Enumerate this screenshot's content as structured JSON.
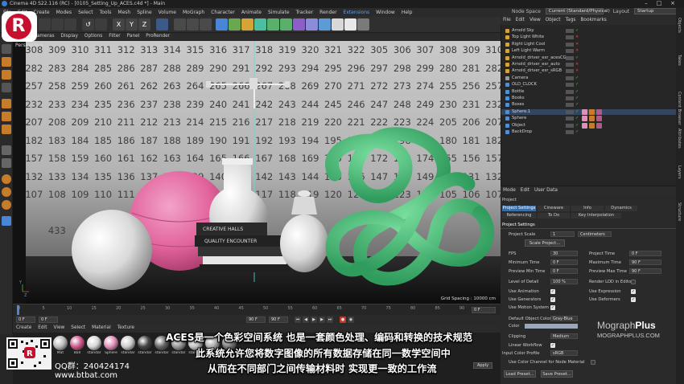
{
  "window": {
    "title": "Cinema 4D S22.116 (RC) - [0105_Setting_Up_ACES.c4d *] - Main"
  },
  "menubar": {
    "items": [
      "File",
      "Edit",
      "Create",
      "Modes",
      "Select",
      "Tools",
      "Mesh",
      "Spline",
      "Volume",
      "MoGraph",
      "Character",
      "Animate",
      "Simulate",
      "Tracker",
      "Render",
      "Extensions",
      "Window",
      "Help"
    ],
    "highlighted": "Extensions"
  },
  "node_space": {
    "label": "Node Space",
    "value": "Current (Standard/Physical)",
    "layout_label": "Layout",
    "layout_value": "Startup"
  },
  "viewport": {
    "menu": [
      "View",
      "Cameras",
      "Display",
      "Options",
      "Filter",
      "Panel",
      "ProRender"
    ],
    "label": "Perspective",
    "grid_spacing": "Grid Spacing : 10000 cm",
    "backdrop_rows": [
      [
        "308",
        "309",
        "310",
        "311",
        "312",
        "313",
        "314",
        "315",
        "316",
        "317",
        "318",
        "319",
        "320",
        "321",
        "322",
        "305",
        "306",
        "307",
        "308",
        "309",
        "310"
      ],
      [
        "282",
        "283",
        "284",
        "285",
        "286",
        "287",
        "288",
        "289",
        "290",
        "291",
        "292",
        "293",
        "294",
        "295",
        "296",
        "297",
        "298",
        "299",
        "280",
        "281",
        "282"
      ],
      [
        "257",
        "258",
        "259",
        "260",
        "261",
        "262",
        "263",
        "264",
        "265",
        "266",
        "267",
        "268",
        "269",
        "270",
        "271",
        "272",
        "273",
        "274",
        "255",
        "256",
        "257"
      ],
      [
        "232",
        "233",
        "234",
        "235",
        "236",
        "237",
        "238",
        "239",
        "240",
        "241",
        "242",
        "243",
        "244",
        "245",
        "246",
        "247",
        "248",
        "249",
        "230",
        "231",
        "232"
      ],
      [
        "207",
        "208",
        "209",
        "210",
        "211",
        "212",
        "213",
        "214",
        "215",
        "216",
        "217",
        "218",
        "219",
        "220",
        "221",
        "222",
        "223",
        "224",
        "205",
        "206",
        "207"
      ],
      [
        "182",
        "183",
        "184",
        "185",
        "186",
        "187",
        "188",
        "189",
        "190",
        "191",
        "192",
        "193",
        "194",
        "195",
        "196",
        "197",
        "198",
        "199",
        "180",
        "181",
        "182"
      ],
      [
        "157",
        "158",
        "159",
        "160",
        "161",
        "162",
        "163",
        "164",
        "165",
        "166",
        "167",
        "168",
        "169",
        "170",
        "171",
        "172",
        "173",
        "174",
        "155",
        "156",
        "157"
      ],
      [
        "132",
        "133",
        "134",
        "135",
        "136",
        "137",
        "138",
        "139",
        "140",
        "141",
        "142",
        "143",
        "144",
        "145",
        "146",
        "147",
        "148",
        "149",
        "130",
        "131",
        "132"
      ],
      [
        "107",
        "108",
        "109",
        "110",
        "111",
        "112",
        "113",
        "114",
        "115",
        "116",
        "117",
        "118",
        "119",
        "120",
        "121",
        "122",
        "123",
        "124",
        "105",
        "106",
        "107"
      ],
      [
        "",
        "",
        "",
        "",
        "",
        "",
        "",
        "",
        "",
        "",
        "",
        "",
        "",
        "",
        "",
        "",
        "",
        "",
        "",
        "",
        ""
      ],
      [
        "",
        "433",
        "",
        "",
        "",
        "",
        "",
        "",
        "",
        "",
        "",
        "",
        "",
        "",
        "",
        "",
        "",
        "",
        "",
        "",
        ""
      ],
      [
        "",
        "",
        "",
        "",
        "",
        "",
        "",
        "",
        "",
        "",
        "",
        "",
        "",
        "",
        "",
        "",
        "",
        "",
        "",
        "",
        ""
      ]
    ]
  },
  "timeline": {
    "ticks": [
      "0",
      "5",
      "10",
      "15",
      "20",
      "25",
      "30",
      "35",
      "40",
      "45",
      "50",
      "55",
      "60",
      "65",
      "70",
      "75",
      "80",
      "85",
      "90"
    ],
    "current_frame": "0 F",
    "start": "0 F",
    "min": "0 F",
    "end": "90 F",
    "max": "90 F"
  },
  "materials": {
    "menu": [
      "Create",
      "Edit",
      "View",
      "Select",
      "Material",
      "Texture"
    ],
    "items": [
      {
        "label": "Mat",
        "color": "#bbbbbb"
      },
      {
        "label": "Ball",
        "color": "#cf5a8e"
      },
      {
        "label": "standar",
        "color": "#d7d7d7"
      },
      {
        "label": "Sphere",
        "color": "#e08fb8"
      },
      {
        "label": "standar",
        "color": "#cccccc"
      },
      {
        "label": "standar",
        "color": "#444444"
      },
      {
        "label": "standar",
        "color": "#666666"
      },
      {
        "label": "standar",
        "color": "#999999"
      },
      {
        "label": "standar",
        "color": "#c5c5c5"
      },
      {
        "label": "standar",
        "color": "#aaaaaa"
      },
      {
        "label": "standar",
        "color": "#777777"
      }
    ]
  },
  "object_manager": {
    "menu": [
      "File",
      "Edit",
      "View",
      "Object",
      "Tags",
      "Bookmarks"
    ],
    "objects": [
      {
        "name": "Arnold Sky",
        "color": "#d4a437",
        "state": "on"
      },
      {
        "name": "Top Light White",
        "color": "#d4a437",
        "state": "off"
      },
      {
        "name": "Right Light Cool",
        "color": "#d4a437",
        "state": "off"
      },
      {
        "name": "Left Light Warm",
        "color": "#d4a437",
        "state": "off"
      },
      {
        "name": "Arnold_driver_exr_acesCG",
        "color": "#d4a437",
        "state": "on"
      },
      {
        "name": "Arnold_driver_exr_auto",
        "color": "#d4a437",
        "state": "off"
      },
      {
        "name": "Arnold_driver_exr_sRGB",
        "color": "#d4a437",
        "state": "off"
      },
      {
        "name": "Camera",
        "color": "#9a9a9a",
        "state": "on"
      },
      {
        "name": "OLD_CLOCK",
        "color": "#4f8fd3",
        "state": "on"
      },
      {
        "name": "Bottle",
        "color": "#4f8fd3",
        "state": "on"
      },
      {
        "name": "Books",
        "color": "#4f8fd3",
        "state": "on"
      },
      {
        "name": "Boxes",
        "color": "#4f8fd3",
        "state": "on"
      },
      {
        "name": "Sphere.1",
        "color": "#4f8fd3",
        "state": "on"
      },
      {
        "name": "Sphere",
        "color": "#4f8fd3",
        "state": "on"
      },
      {
        "name": "Object",
        "color": "#4f8fd3",
        "state": "on"
      },
      {
        "name": "BackDrop",
        "color": "#4f8fd3",
        "state": "on"
      }
    ]
  },
  "attributes": {
    "menu": [
      "Mode",
      "Edit",
      "User Data"
    ],
    "title": "Project",
    "tabs_row1": [
      "Project Settings",
      "Cineware",
      "Info",
      "Dynamics"
    ],
    "tabs_row2": [
      "Referencing",
      "To Do",
      "Key Interpolation"
    ],
    "section": "Project Settings",
    "project_scale_label": "Project Scale",
    "project_scale_value": "1",
    "project_scale_unit": "Centimeters",
    "scale_project_button": "Scale Project...",
    "fps_label": "FPS",
    "fps_value": "30",
    "project_time_label": "Project Time",
    "project_time_value": "0 F",
    "min_time_label": "Minimum Time",
    "min_time_value": "0 F",
    "max_time_label": "Maximum Time",
    "max_time_value": "90 F",
    "prev_min_label": "Preview Min Time",
    "prev_min_value": "0 F",
    "prev_max_label": "Preview Max Time",
    "prev_max_value": "90 F",
    "lod_label": "Level of Detail",
    "lod_value": "100 %",
    "render_lod_label": "Render LOD in Editor",
    "use_animation": "Use Animation",
    "use_expression": "Use Expression",
    "use_generators": "Use Generators",
    "use_deformers": "Use Deformers",
    "use_motion_system": "Use Motion System",
    "default_obj_color_label": "Default Object Color",
    "default_obj_color_value": "Gray-Blue",
    "color_label": "Color",
    "clipping_label": "Clipping",
    "clipping_value": "Medium",
    "linear_workflow_label": "Linear Workflow",
    "input_color_profile_label": "Input Color Profile",
    "input_color_profile_value": "sRGB",
    "use_color_channel_label": "Use Color Channel for Node Material",
    "load_preset": "Load Preset...",
    "save_preset": "Save Preset..."
  },
  "right_tabs": [
    "Objects",
    "Takes",
    "Content Browser",
    "Attributes",
    "Layers",
    "Structure"
  ],
  "mograph_watermark": {
    "title_a": "Mograph",
    "title_b": "Plus",
    "url": "MOGRAPHPLUS.COM"
  },
  "overlay": {
    "qq": "QQ群：240424174",
    "site": "www.btbat.com",
    "subtitle_lines": [
      "ACES是一个色彩空间系统 也是一套颜色处理、编码和转换的技术规范",
      "此系统允许您将数字图像的所有数据存储在同一数学空间中",
      "从而在不同部门之间传输材料时 实现更一致的工作流"
    ],
    "apply": "Apply"
  }
}
